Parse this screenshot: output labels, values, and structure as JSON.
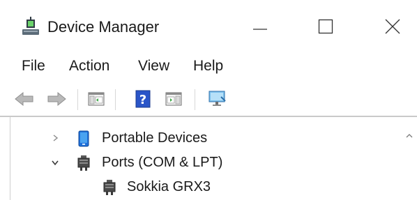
{
  "window": {
    "title": "Device Manager",
    "controls": {
      "minimize_icon": "minimize-icon",
      "maximize_icon": "maximize-icon",
      "close_icon": "close-icon"
    }
  },
  "menu": {
    "items": [
      {
        "label": "File"
      },
      {
        "label": "Action"
      },
      {
        "label": "View"
      },
      {
        "label": "Help"
      }
    ]
  },
  "toolbar": {
    "buttons": [
      {
        "icon": "back-arrow-icon"
      },
      {
        "icon": "forward-arrow-icon"
      },
      {
        "icon": "show-hide-console-tree-icon"
      },
      {
        "icon": "help-icon"
      },
      {
        "icon": "show-hide-action-pane-icon"
      },
      {
        "icon": "monitor-icon"
      }
    ]
  },
  "tree": {
    "nodes": [
      {
        "label": "Portable Devices",
        "expanded": false,
        "icon": "portable-device-icon"
      },
      {
        "label": "Ports (COM & LPT)",
        "expanded": true,
        "icon": "port-icon"
      },
      {
        "label": "Sokkia GRX3",
        "icon": "port-icon",
        "level": 2
      }
    ]
  },
  "colors": {
    "accent": "#1e6fd9",
    "text": "#1a1a1a",
    "separator": "#c9c9c9"
  }
}
